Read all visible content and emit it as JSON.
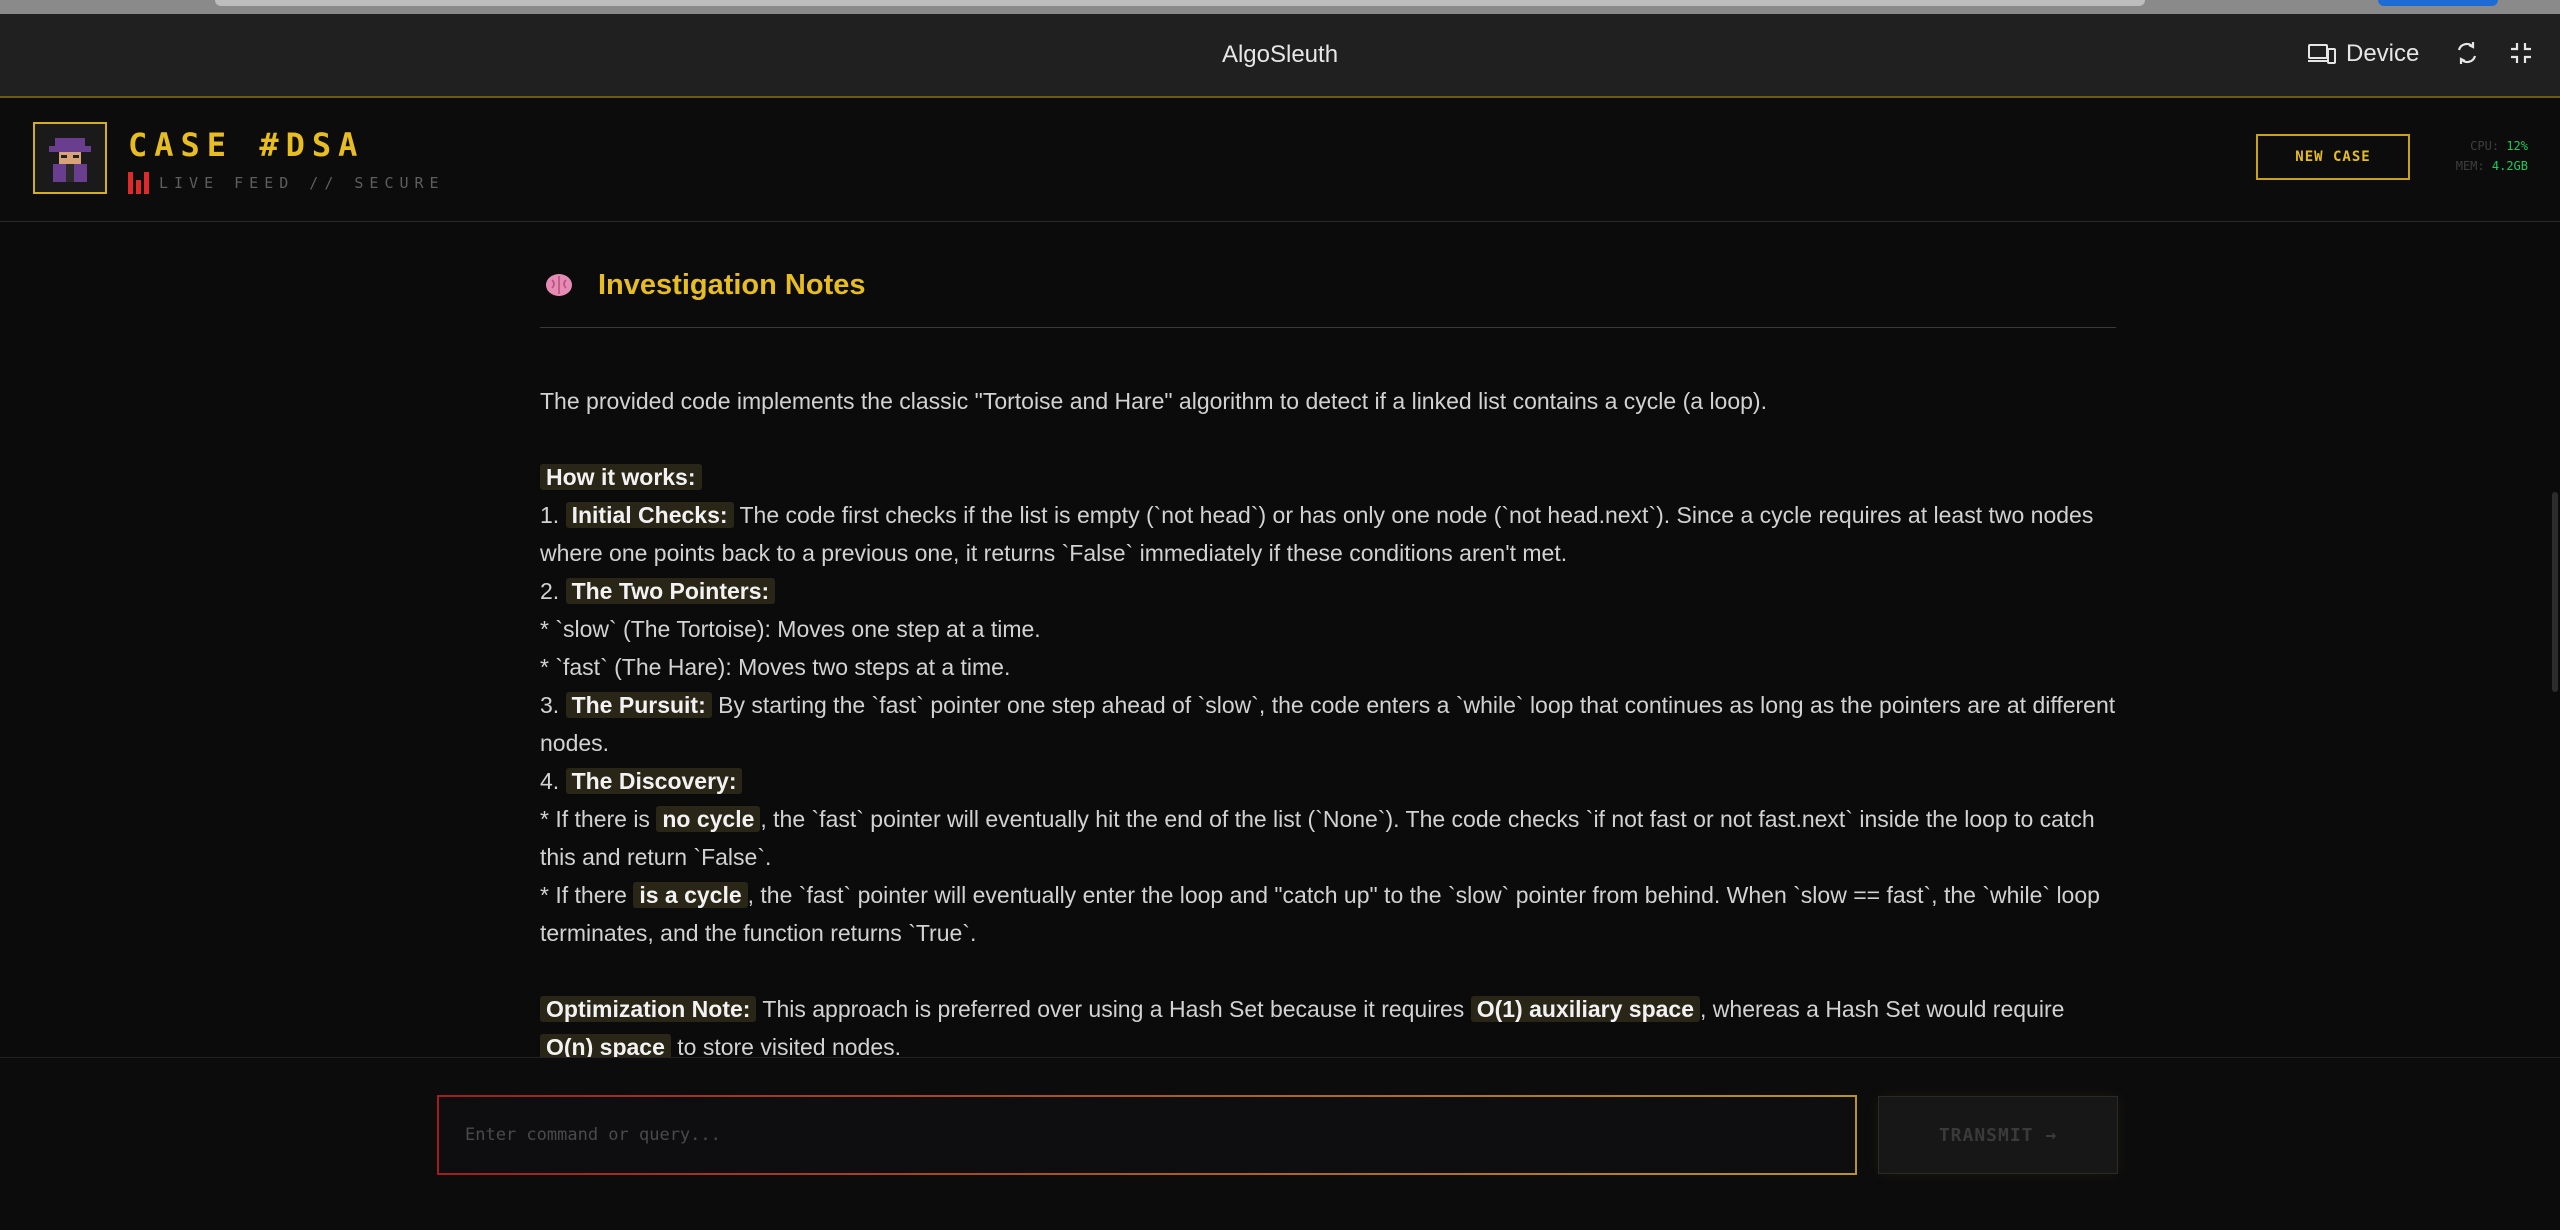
{
  "window": {
    "title": "AlgoSleuth",
    "device_label": "Device"
  },
  "header": {
    "case_title": "CASE #DSA",
    "live_feed": "LIVE FEED // SECURE",
    "new_case_label": "NEW CASE",
    "stats": {
      "cpu_label": "CPU:",
      "cpu_value": "12%",
      "mem_label": "MEM:",
      "mem_value": "4.2GB"
    }
  },
  "notes": {
    "heading": "Investigation Notes",
    "intro": "The provided code implements the classic \"Tortoise and Hare\" algorithm to detect if a linked list contains a cycle (a loop).",
    "how_it_works": "How it works:",
    "step1_num": "1.",
    "step1_title": "Initial Checks:",
    "step1_text": " The code first checks if the list is empty (`not head`) or has only one node (`not head.next`). Since a cycle requires at least two nodes where one points back to a previous one, it returns `False` immediately if these conditions aren't met.",
    "step2_num": "2.",
    "step2_title": "The Two Pointers:",
    "step2_bullet1": "* `slow` (The Tortoise): Moves one step at a time.",
    "step2_bullet2": "* `fast` (The Hare): Moves two steps at a time.",
    "step3_num": "3.",
    "step3_title": "The Pursuit:",
    "step3_text": " By starting the `fast` pointer one step ahead of `slow`, the code enters a `while` loop that continues as long as the pointers are at different nodes.",
    "step4_num": "4.",
    "step4_title": "The Discovery:",
    "step4_b1_pre": "* If there is ",
    "step4_b1_hl": "no cycle",
    "step4_b1_post": ", the `fast` pointer will eventually hit the end of the list (`None`). The code checks `if not fast or not fast.next` inside the loop to catch this and return `False`.",
    "step4_b2_pre": "* If there ",
    "step4_b2_hl": "is a cycle",
    "step4_b2_post": ", the `fast` pointer will eventually enter the loop and \"catch up\" to the `slow` pointer from behind. When `slow == fast`, the `while` loop terminates, and the function returns `True`.",
    "opt_title": "Optimization Note:",
    "opt_pre": " This approach is preferred over using a Hash Set because it requires ",
    "opt_hl1": "O(1) auxiliary space",
    "opt_mid": ", whereas a Hash Set would require ",
    "opt_hl2": "O(n) space",
    "opt_post": " to store visited nodes."
  },
  "footer": {
    "input_placeholder": "Enter command or query...",
    "input_value": "",
    "transmit_label": "TRANSMIT →"
  },
  "colors": {
    "accent": "#e7bd22",
    "alert_red": "#e02a2a",
    "stat_green": "#20c95a"
  },
  "icons": [
    "device-icon",
    "sync-icon",
    "fullscreen-icon",
    "detective-avatar-icon",
    "signal-bars-icon",
    "brain-icon",
    "arrow-right-icon"
  ]
}
